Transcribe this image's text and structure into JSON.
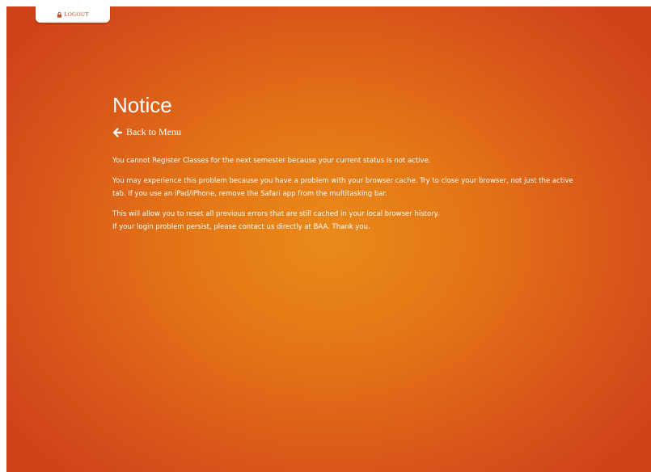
{
  "header": {
    "logout_label": "LOGOUT",
    "logout_icon": "lock-icon"
  },
  "main": {
    "title": "Notice",
    "back_link": {
      "label": "Back to Menu",
      "icon": "arrow-left-icon"
    },
    "paragraphs": [
      [
        "You cannot Register Classes for the next semester because your current status is not active."
      ],
      [
        "You may experience this problem because you have a problem with your browser cache. Try to close your browser, not just the active tab. If you use an iPad/iPhone, remove the Safari app from the multitasking bar."
      ],
      [
        "This will allow you to reset all previous errors that are still cached in your local browser history.",
        "If your login problem persist, please contact us directly at BAA. Thank you."
      ]
    ]
  },
  "colors": {
    "background_center": "#ea8a1a",
    "background_edge": "#cf421a",
    "text": "#ffffff",
    "logout_text": "#c8431a"
  }
}
